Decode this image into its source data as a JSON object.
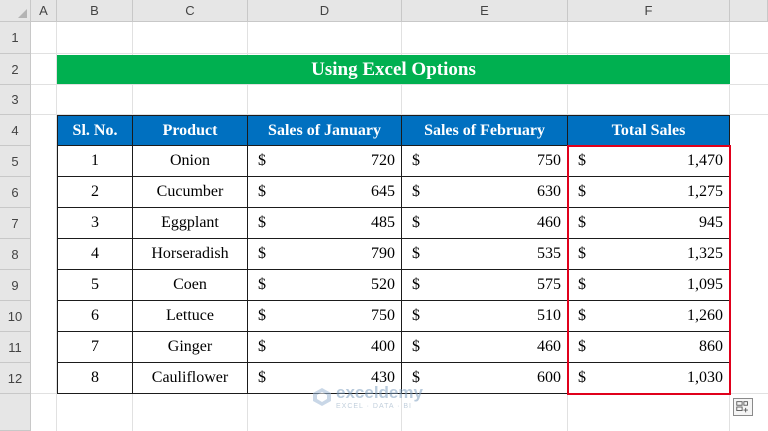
{
  "columns": [
    "A",
    "B",
    "C",
    "D",
    "E",
    "F"
  ],
  "rows": [
    "1",
    "2",
    "3",
    "4",
    "5",
    "6",
    "7",
    "8",
    "9",
    "10",
    "11",
    "12"
  ],
  "title": "Using Excel Options",
  "table": {
    "headers": [
      "Sl. No.",
      "Product",
      "Sales of January",
      "Sales of February",
      "Total Sales"
    ],
    "currency_symbol": "$",
    "rows": [
      {
        "sl": "1",
        "product": "Onion",
        "jan": "720",
        "feb": "750",
        "total": "1,470"
      },
      {
        "sl": "2",
        "product": "Cucumber",
        "jan": "645",
        "feb": "630",
        "total": "1,275"
      },
      {
        "sl": "3",
        "product": "Eggplant",
        "jan": "485",
        "feb": "460",
        "total": "945"
      },
      {
        "sl": "4",
        "product": "Horseradish",
        "jan": "790",
        "feb": "535",
        "total": "1,325"
      },
      {
        "sl": "5",
        "product": "Coen",
        "jan": "520",
        "feb": "575",
        "total": "1,095"
      },
      {
        "sl": "6",
        "product": "Lettuce",
        "jan": "750",
        "feb": "510",
        "total": "1,260"
      },
      {
        "sl": "7",
        "product": "Ginger",
        "jan": "400",
        "feb": "460",
        "total": "860"
      },
      {
        "sl": "8",
        "product": "Cauliflower",
        "jan": "430",
        "feb": "600",
        "total": "1,030"
      }
    ]
  },
  "watermark": {
    "name": "exceldemy",
    "tagline": "EXCEL · DATA · BI"
  },
  "colors": {
    "title_bg": "#00b050",
    "header_bg": "#0070c0",
    "highlight": "#e0001b"
  }
}
